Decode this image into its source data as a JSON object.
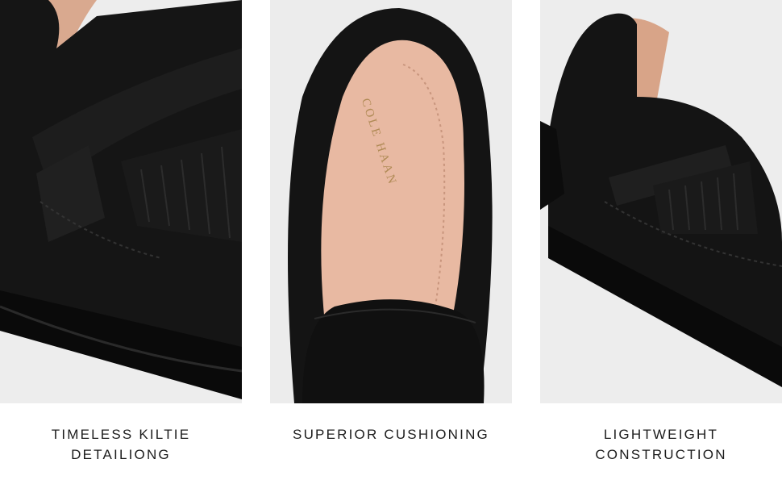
{
  "panels": [
    {
      "caption_lines": [
        "TIMELESS KILTIE",
        "DETAILIONG"
      ],
      "photo_icon": "kiltie-loafer-closeup"
    },
    {
      "caption_lines": [
        "SUPERIOR CUSHIONING"
      ],
      "photo_icon": "footbed-closeup",
      "brand_mark": "COLE HAAN"
    },
    {
      "caption_lines": [
        "LIGHTWEIGHT",
        "CONSTRUCTION"
      ],
      "photo_icon": "loafer-side-view"
    }
  ],
  "colors": {
    "suede": "#121212",
    "lining": "#e7b8a0",
    "background": "#ececec",
    "text": "#1c1c1c"
  }
}
